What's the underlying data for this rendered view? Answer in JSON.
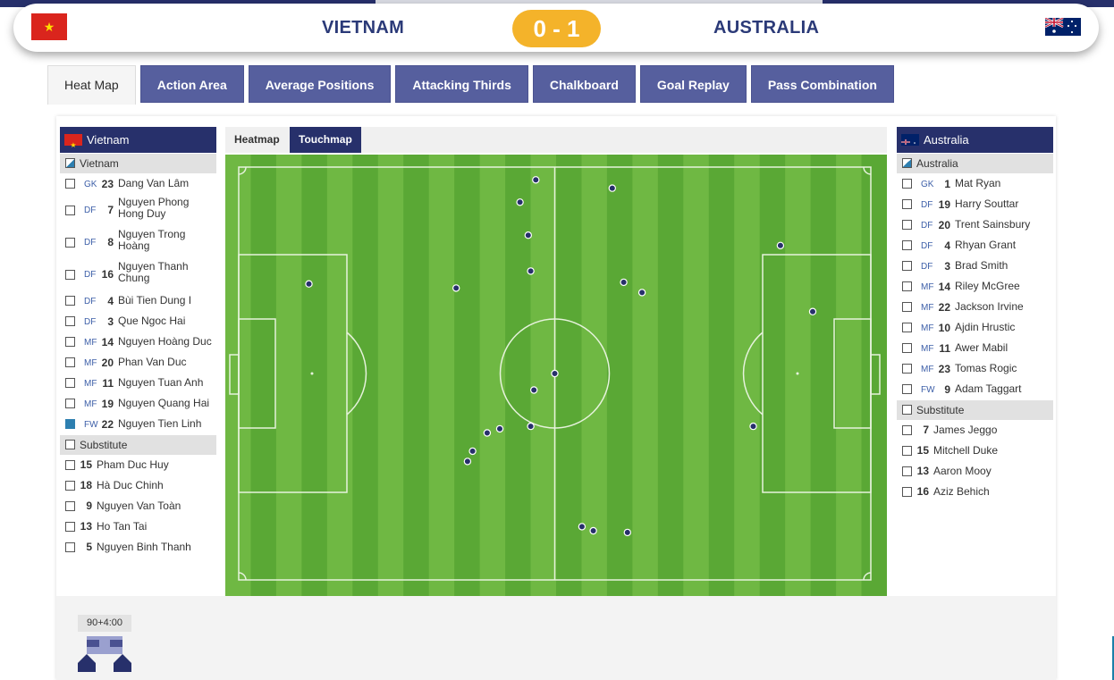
{
  "match": {
    "home_team": "VIETNAM",
    "away_team": "AUSTRALIA",
    "score": "0 - 1"
  },
  "tabs": [
    "Heat Map",
    "Action Area",
    "Average Positions",
    "Attacking Thirds",
    "Chalkboard",
    "Goal Replay",
    "Pass Combination"
  ],
  "active_tab": "Heat Map",
  "subtabs": [
    "Heatmap",
    "Touchmap"
  ],
  "active_subtab": "Touchmap",
  "home": {
    "name": "Vietnam",
    "group_label": "Vietnam",
    "substitute_label": "Substitute",
    "players": [
      {
        "pos": "GK",
        "num": "23",
        "name": "Dang Van Lâm",
        "checked": false
      },
      {
        "pos": "DF",
        "num": "7",
        "name": "Nguyen Phong Hong Duy",
        "checked": false
      },
      {
        "pos": "DF",
        "num": "8",
        "name": "Nguyen Trong Hoàng",
        "checked": false
      },
      {
        "pos": "DF",
        "num": "16",
        "name": "Nguyen Thanh Chung",
        "checked": false
      },
      {
        "pos": "DF",
        "num": "4",
        "name": "Bùi Tien Dung I",
        "checked": false
      },
      {
        "pos": "DF",
        "num": "3",
        "name": "Que Ngoc Hai",
        "checked": false
      },
      {
        "pos": "MF",
        "num": "14",
        "name": "Nguyen Hoàng Duc",
        "checked": false
      },
      {
        "pos": "MF",
        "num": "20",
        "name": "Phan Van Duc",
        "checked": false
      },
      {
        "pos": "MF",
        "num": "11",
        "name": "Nguyen Tuan Anh",
        "checked": false
      },
      {
        "pos": "MF",
        "num": "19",
        "name": "Nguyen Quang Hai",
        "checked": false
      },
      {
        "pos": "FW",
        "num": "22",
        "name": "Nguyen Tien Linh",
        "checked": true
      }
    ],
    "substitutes": [
      {
        "num": "15",
        "name": "Pham Duc Huy"
      },
      {
        "num": "18",
        "name": "Hà Duc Chinh"
      },
      {
        "num": "9",
        "name": "Nguyen Van Toàn"
      },
      {
        "num": "13",
        "name": "Ho Tan Tai"
      },
      {
        "num": "5",
        "name": "Nguyen Binh Thanh"
      }
    ]
  },
  "away": {
    "name": "Australia",
    "group_label": "Australia",
    "substitute_label": "Substitute",
    "players": [
      {
        "pos": "GK",
        "num": "1",
        "name": "Mat Ryan",
        "checked": false
      },
      {
        "pos": "DF",
        "num": "19",
        "name": "Harry Souttar",
        "checked": false
      },
      {
        "pos": "DF",
        "num": "20",
        "name": "Trent Sainsbury",
        "checked": false
      },
      {
        "pos": "DF",
        "num": "4",
        "name": "Rhyan Grant",
        "checked": false
      },
      {
        "pos": "DF",
        "num": "3",
        "name": "Brad Smith",
        "checked": false
      },
      {
        "pos": "MF",
        "num": "14",
        "name": "Riley McGree",
        "checked": false
      },
      {
        "pos": "MF",
        "num": "22",
        "name": "Jackson Irvine",
        "checked": false
      },
      {
        "pos": "MF",
        "num": "10",
        "name": "Ajdin Hrustic",
        "checked": false
      },
      {
        "pos": "MF",
        "num": "11",
        "name": "Awer Mabil",
        "checked": false
      },
      {
        "pos": "MF",
        "num": "23",
        "name": "Tomas Rogic",
        "checked": false
      },
      {
        "pos": "FW",
        "num": "9",
        "name": "Adam Taggart",
        "checked": false
      }
    ],
    "substitutes": [
      {
        "num": "7",
        "name": "James Jeggo"
      },
      {
        "num": "15",
        "name": "Mitchell Duke"
      },
      {
        "num": "13",
        "name": "Aaron Mooy"
      },
      {
        "num": "16",
        "name": "Aziz Behich"
      }
    ]
  },
  "touches": [
    [
      47.0,
      3.1
    ],
    [
      44.5,
      8.5
    ],
    [
      59.1,
      5.1
    ],
    [
      45.8,
      16.5
    ],
    [
      46.2,
      25.2
    ],
    [
      85.7,
      19.0
    ],
    [
      34.4,
      29.3
    ],
    [
      11.1,
      28.3
    ],
    [
      60.9,
      27.9
    ],
    [
      63.8,
      30.4
    ],
    [
      90.8,
      35.0
    ],
    [
      50.0,
      50.0
    ],
    [
      46.7,
      54.0
    ],
    [
      46.2,
      62.8
    ],
    [
      41.3,
      63.4
    ],
    [
      39.3,
      64.4
    ],
    [
      81.4,
      62.8
    ],
    [
      37.0,
      68.8
    ],
    [
      36.2,
      71.3
    ],
    [
      54.3,
      87.1
    ],
    [
      56.1,
      88.1
    ],
    [
      61.5,
      88.5
    ]
  ],
  "timeline": {
    "time_label": "90+4:00"
  },
  "colors": {
    "navy": "#27306b",
    "tab_blue": "#565f9e",
    "gold": "#f4b32a",
    "pitch_light": "#6fb843",
    "pitch_dark": "#5aa835"
  }
}
